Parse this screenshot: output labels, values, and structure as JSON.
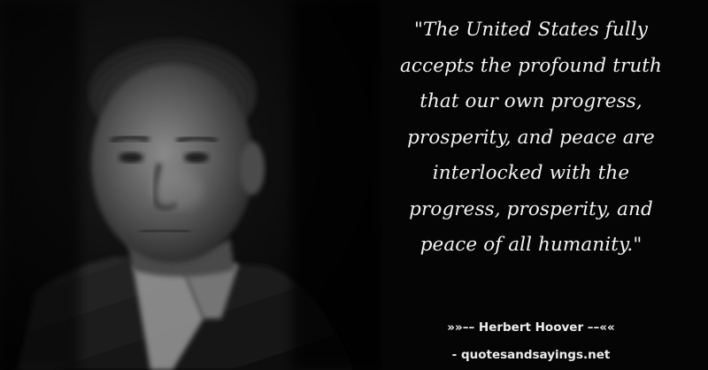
{
  "quote": {
    "lines": [
      "\"The United States fully",
      "accepts the profound truth",
      "that our own progress,",
      "prosperity, and peace are",
      "interlocked with the",
      "progress, prosperity, and",
      "peace of all humanity.\""
    ]
  },
  "attribution": {
    "author": "»»–– Herbert Hoover ––««",
    "source": "- quotesandsayings.net"
  }
}
